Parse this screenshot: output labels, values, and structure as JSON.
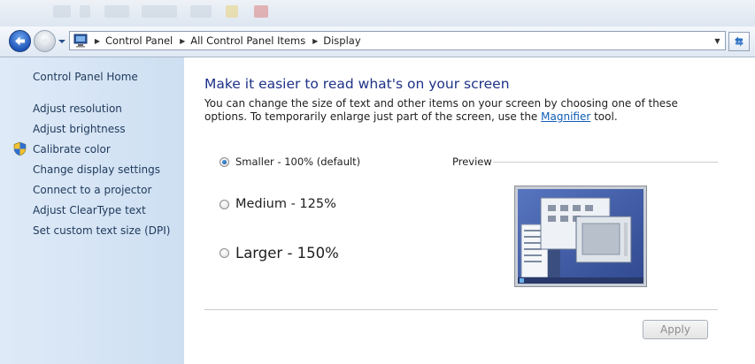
{
  "breadcrumb": [
    "Control Panel",
    "All Control Panel Items",
    "Display"
  ],
  "sidebar": {
    "home": "Control Panel Home",
    "links": [
      {
        "label": "Adjust resolution",
        "icon": ""
      },
      {
        "label": "Adjust brightness",
        "icon": ""
      },
      {
        "label": "Calibrate color",
        "icon": "shield-icon"
      },
      {
        "label": "Change display settings",
        "icon": ""
      },
      {
        "label": "Connect to a projector",
        "icon": ""
      },
      {
        "label": "Adjust ClearType text",
        "icon": ""
      },
      {
        "label": "Set custom text size (DPI)",
        "icon": ""
      }
    ]
  },
  "main": {
    "title": "Make it easier to read what's on your screen",
    "description_prefix": "You can change the size of text and other items on your screen by choosing one of these options. To temporarily enlarge just part of the screen, use the ",
    "magnifier_link": "Magnifier",
    "description_suffix": " tool.",
    "options": [
      {
        "label": "Smaller - 100% (default)",
        "checked": true
      },
      {
        "label": "Medium - 125%",
        "checked": false
      },
      {
        "label": "Larger - 150%",
        "checked": false
      }
    ],
    "preview_label": "Preview",
    "apply_label": "Apply"
  },
  "colors": {
    "accent_title": "#1e3287",
    "link": "#0f5db4",
    "sidebar_bg": "#d6e4f4"
  }
}
